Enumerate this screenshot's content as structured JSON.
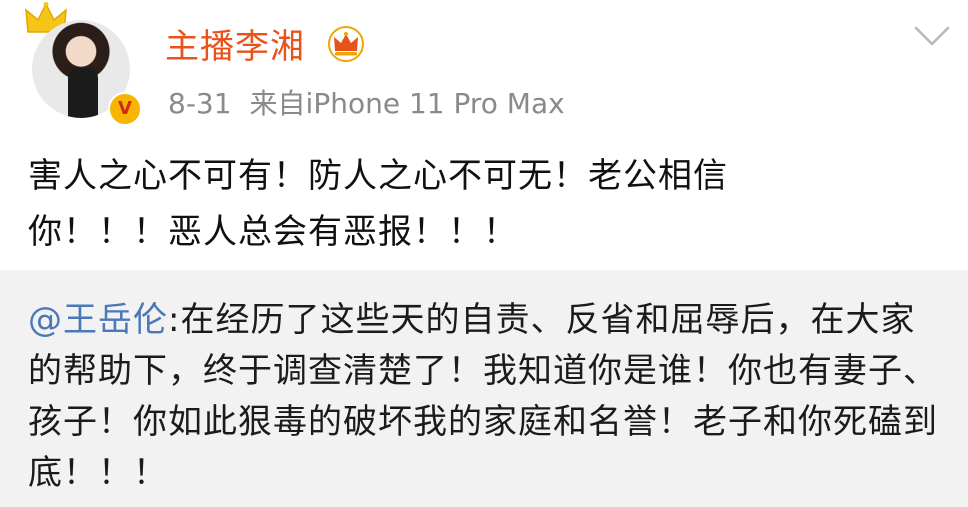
{
  "author": {
    "name": "主播李湘",
    "avatar_icon": "avatar-photo",
    "verified_icon": "verified-v-icon",
    "verified_glyph": "V",
    "vip_icon": "crown-icon"
  },
  "meta": {
    "date": "8-31",
    "source": "来自iPhone 11 Pro Max"
  },
  "menu": {
    "icon": "chevron-down-icon"
  },
  "post": {
    "lines": [
      "害人之心不可有！防人之心不可无！老公相信",
      "你！！！恶人总会有恶报！！！"
    ]
  },
  "repost": {
    "mention": "@王岳伦",
    "text": ":在经历了这些天的自责、反省和屈辱后，在大家的帮助下，终于调查清楚了！我知道你是谁！你也有妻子、孩子！你如此狠毒的破坏我的家庭和名誉！老子和你死磕到底！！！"
  },
  "colors": {
    "username": "#e8531c",
    "mention": "#4a78b8",
    "meta": "#8a8a8a",
    "repost_bg": "#f2f2f2",
    "badge": "#f7b500"
  }
}
